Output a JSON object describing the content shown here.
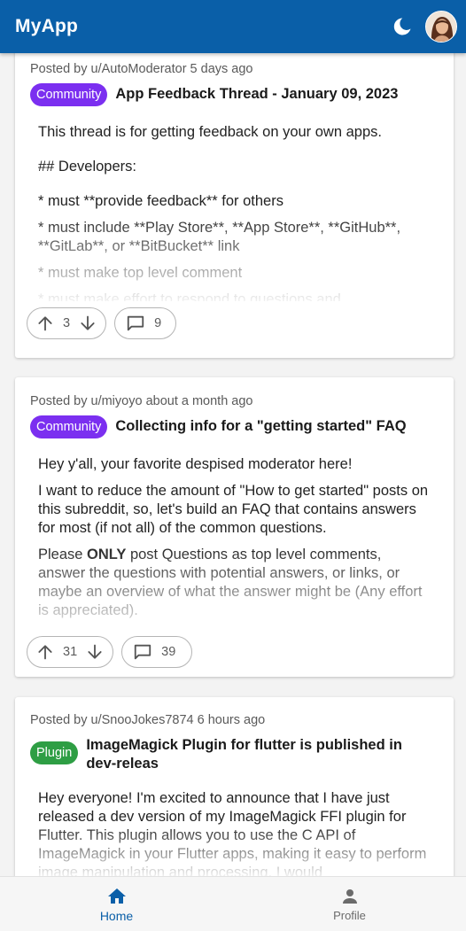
{
  "app": {
    "title": "MyApp"
  },
  "posts": [
    {
      "meta": "Posted by u/AutoModerator 5 days ago",
      "flair": "Community",
      "flair_color": "#7b2ff0",
      "title": "App Feedback Thread - January 09, 2023",
      "body": [
        "This thread is for getting feedback on your own apps.",
        "## Developers:",
        "* must **provide feedback** for others",
        "* must include **Play Store**, **App Store**, **GitHub**, **GitLab**, or **BitBucket** link",
        "* must make top level comment",
        "* must make effort to respond to questions and"
      ],
      "votes": "3",
      "comments": "9"
    },
    {
      "meta": "Posted by u/miyoyo about a month ago",
      "flair": "Community",
      "flair_color": "#7b2ff0",
      "title": "Collecting info for a \"getting started\" FAQ",
      "body": [
        "Hey y'all, your favorite despised moderator here!",
        "I want to reduce the amount of \"How to get started\" posts on this subreddit, so, let's build an FAQ that contains answers for most (if not all) of the common questions."
      ],
      "body_rich": {
        "before": "Please ",
        "bold": "ONLY",
        "after": " post Questions as top level comments, answer the questions with potential answers, or links, or maybe an overview of what the answer might be (Any effort is appreciated)."
      },
      "votes": "31",
      "comments": "39"
    },
    {
      "meta": "Posted by u/SnooJokes7874 6 hours ago",
      "flair": "Plugin",
      "flair_color": "#2e9e44",
      "title": "ImageMagick Plugin for flutter is published in dev-releas",
      "body": [
        "Hey everyone! I'm excited to announce that I have just released a dev version of my ImageMagick FFI plugin for Flutter. This plugin allows you to use the C API of ImageMagick in your Flutter apps, making it easy to perform image manipulation and processing. I would"
      ]
    }
  ],
  "nav": {
    "home": "Home",
    "profile": "Profile",
    "active_color": "#0a5fa8",
    "inactive_color": "#6b6b6b"
  }
}
